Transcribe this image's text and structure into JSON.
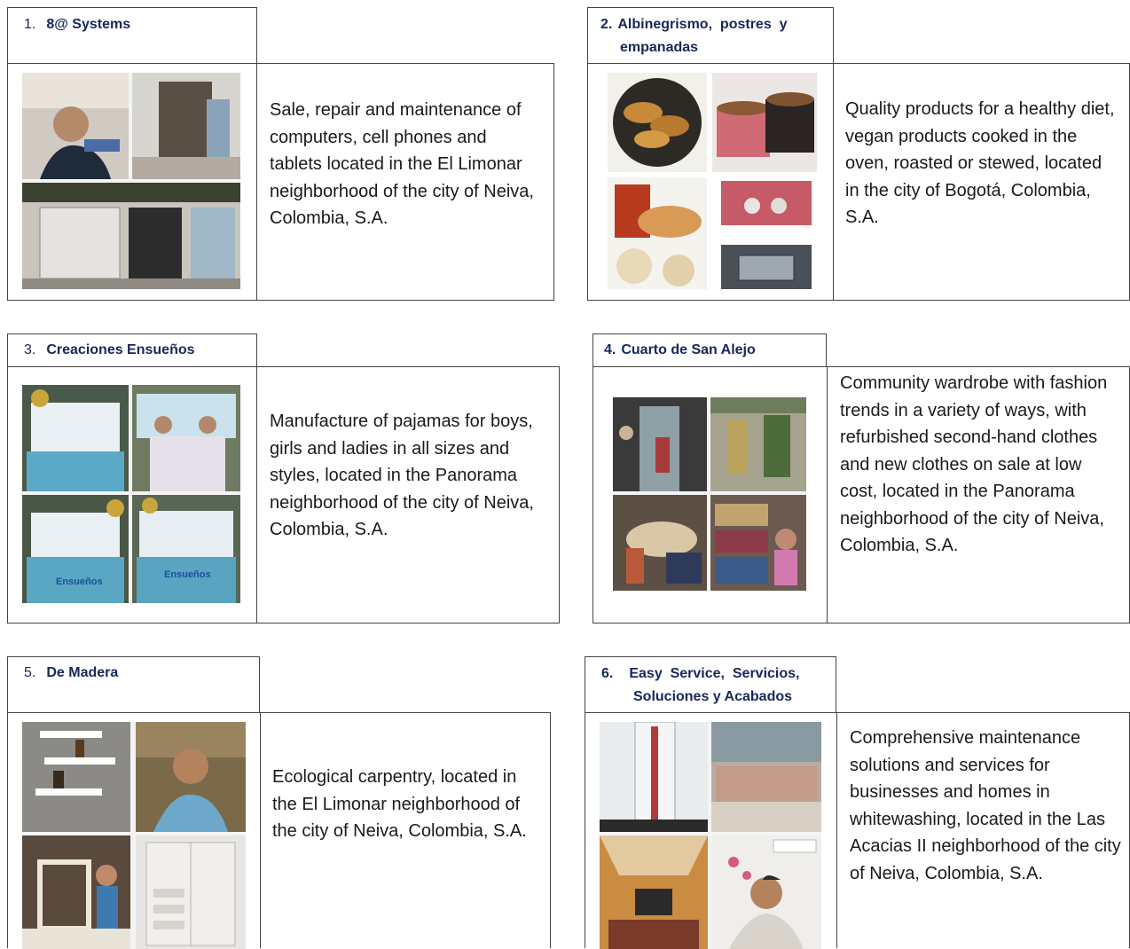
{
  "entries": [
    {
      "number": "1.",
      "name": "8@ Systems",
      "description": "Sale, repair and maintenance of computers, cell phones and tablets located in the El Limonar neighborhood of the city of Neiva, Colombia, S.A."
    },
    {
      "number": "2.",
      "name": "Albinegrismo, postres y empanadas",
      "name_line1": "Albinegrismo,  postres  y",
      "name_line2": "empanadas",
      "description": "Quality products for a healthy diet, vegan products cooked in the oven, roasted or stewed, located in the city of Bogotá, Colombia, S.A."
    },
    {
      "number": "3.",
      "name": "Creaciones Ensueños",
      "description": "Manufacture of pajamas for boys, girls and ladies in all sizes and styles, located in the Panorama neighborhood of the city of Neiva, Colombia, S.A.",
      "photo_logo_text": "Ensueños"
    },
    {
      "number": "4.",
      "name": "Cuarto de San Alejo",
      "description": "Community wardrobe with fashion trends in a variety of ways, with refurbished second-hand clothes and new clothes on sale at low cost, located in the Panorama neighborhood of the city of Neiva, Colombia, S.A."
    },
    {
      "number": "5.",
      "name": "De Madera",
      "description": "Ecological carpentry, located in the El Limonar neighborhood of the city of Neiva, Colombia, S.A."
    },
    {
      "number": "6.",
      "name": "Easy Service, Servicios, Soluciones y Acabados",
      "name_line1": "Easy  Service,  Servicios,",
      "name_line2": "Soluciones y Acabados",
      "description": "Comprehensive maintenance solutions and services for businesses and homes in whitewashing, located in the Las Acacias II neighborhood of the city of Neiva, Colombia, S.A."
    }
  ]
}
